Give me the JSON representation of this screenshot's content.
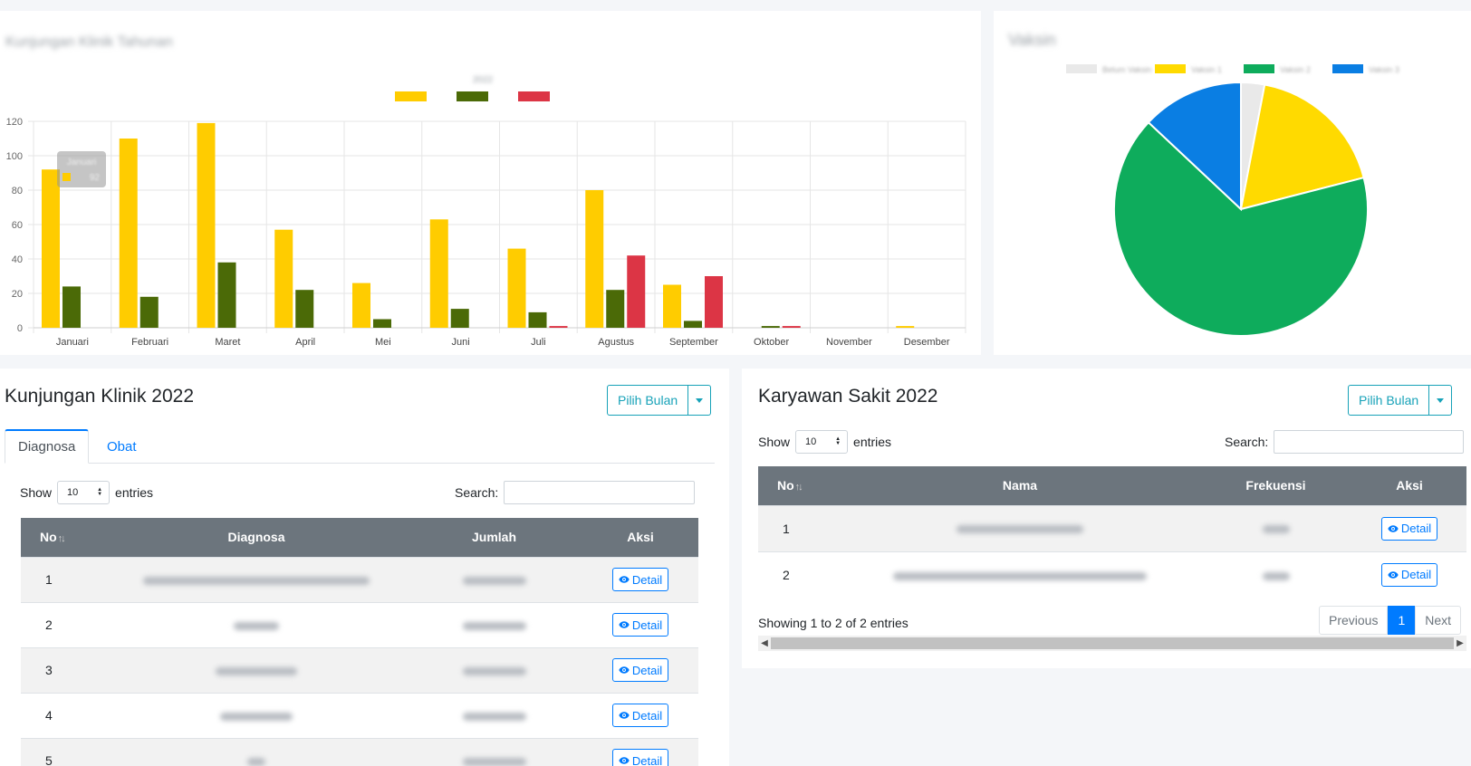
{
  "bar_card": {
    "title": "Kunjungan Klinik Tahunan",
    "chart_title": "2022"
  },
  "pie_card": {
    "title": "Vaksin"
  },
  "chart_data": [
    {
      "type": "bar",
      "title": "2022",
      "categories": [
        "Januari",
        "Februari",
        "Maret",
        "April",
        "Mei",
        "Juni",
        "Juli",
        "Agustus",
        "September",
        "Oktober",
        "November",
        "Desember"
      ],
      "series": [
        {
          "name": "",
          "color": "#ffcc00",
          "values": [
            92,
            110,
            119,
            57,
            26,
            63,
            46,
            80,
            25,
            0,
            0,
            1
          ]
        },
        {
          "name": "",
          "color": "#4b6a07",
          "values": [
            24,
            18,
            38,
            22,
            5,
            11,
            9,
            22,
            4,
            1,
            0,
            0
          ]
        },
        {
          "name": "",
          "color": "#dc3545",
          "values": [
            0,
            0,
            0,
            0,
            0,
            0,
            1,
            42,
            30,
            1,
            0,
            0
          ]
        }
      ],
      "ylim": [
        0,
        120
      ],
      "yticks": [
        0,
        20,
        40,
        60,
        80,
        100,
        120
      ],
      "grid": true,
      "legend": "top",
      "tooltip": {
        "label": "Januari",
        "value": "92"
      }
    },
    {
      "type": "pie",
      "title": "",
      "labels": [
        "Belum Vaksin",
        "Vaksin 1",
        "Vaksin 2",
        "Vaksin 3"
      ],
      "values": [
        3,
        18,
        66,
        13
      ],
      "colors": [
        "#e9e9e9",
        "#ffda00",
        "#0eac5c",
        "#0a7ee3"
      ],
      "legend": "top"
    }
  ],
  "klinik": {
    "title": "Kunjungan Klinik 2022",
    "pilih_bulan": "Pilih Bulan",
    "tabs": [
      "Diagnosa",
      "Obat"
    ],
    "show": "Show",
    "length": "10",
    "entries": "entries",
    "search": "Search:",
    "columns": [
      "No",
      "Diagnosa",
      "Jumlah",
      "Aksi"
    ],
    "rows": [
      {
        "no": "1",
        "detail": "Detail"
      },
      {
        "no": "2",
        "detail": "Detail"
      },
      {
        "no": "3",
        "detail": "Detail"
      },
      {
        "no": "4",
        "detail": "Detail"
      },
      {
        "no": "5",
        "detail": "Detail"
      }
    ]
  },
  "sakit": {
    "title": "Karyawan Sakit 2022",
    "pilih_bulan": "Pilih Bulan",
    "show": "Show",
    "length": "10",
    "entries": "entries",
    "search": "Search:",
    "columns": [
      "No",
      "Nama",
      "Frekuensi",
      "Aksi"
    ],
    "rows": [
      {
        "no": "1",
        "detail": "Detail"
      },
      {
        "no": "2",
        "detail": "Detail"
      }
    ],
    "info": "Showing 1 to 2 of 2 entries",
    "pager": {
      "previous": "Previous",
      "page": "1",
      "next": "Next"
    }
  }
}
